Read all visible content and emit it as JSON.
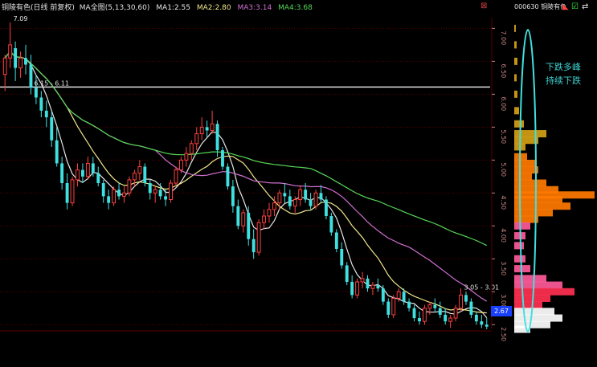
{
  "header": {
    "title": "铜陵有色(日线 前复权)",
    "ma_label": "MA全图(5,13,30,60)",
    "ma_values": [
      {
        "name": "MA1:",
        "value": "2.55",
        "color": "#e6e6e6"
      },
      {
        "name": "MA2:",
        "value": "2.80",
        "color": "#f0e68c"
      },
      {
        "name": "MA3:",
        "value": "3.14",
        "color": "#d070d0"
      },
      {
        "name": "MA4:",
        "value": "3.68",
        "color": "#56d856"
      }
    ]
  },
  "side_panel": {
    "code_label": "000630 铜陵有色",
    "annotation_line1": "下跌多峰",
    "annotation_line2": "持续下跌",
    "current_price": "2.67"
  },
  "colors": {
    "up": "#ff4040",
    "down": "#40e0e0",
    "grid": "#5a0000",
    "axis_text": "#c08080",
    "ma1": "#e6e6e6",
    "ma2": "#f0e68c",
    "ma3": "#d070d0",
    "ma4": "#56d856",
    "hline": "#dddddd",
    "price_box": "#1a40ff",
    "ellipse": "#40e0e0",
    "annotation": "#40d0d0"
  },
  "chart_data": {
    "type": "candlestick",
    "y_axis_ticks": [
      "7.00",
      "6.50",
      "6.00",
      "5.50",
      "5.00",
      "4.50",
      "4.00",
      "3.50",
      "3.00",
      "2.50"
    ],
    "ylim": [
      2.43,
      7.09
    ],
    "annotations": [
      {
        "text": "7.09",
        "price": 7.09,
        "index": 1
      },
      {
        "text": "6.15 - 6.11",
        "price": 6.11,
        "index": 5
      },
      {
        "text": "3.05 - 3.01",
        "price": 3.01,
        "index": 88
      }
    ],
    "horizontal_line_price": 6.11,
    "current_price": 2.67,
    "candles": [
      [
        6.3,
        6.6,
        6.05,
        6.55
      ],
      [
        6.55,
        7.09,
        6.4,
        6.75
      ],
      [
        6.7,
        6.8,
        6.2,
        6.4
      ],
      [
        6.4,
        6.65,
        6.25,
        6.55
      ],
      [
        6.55,
        6.75,
        6.3,
        6.45
      ],
      [
        6.45,
        6.6,
        6.0,
        6.1
      ],
      [
        6.1,
        6.3,
        5.85,
        5.95
      ],
      [
        5.95,
        6.05,
        5.65,
        5.75
      ],
      [
        5.75,
        5.9,
        5.5,
        5.65
      ],
      [
        5.65,
        5.75,
        5.2,
        5.3
      ],
      [
        5.3,
        5.5,
        4.9,
        4.95
      ],
      [
        4.95,
        5.05,
        4.55,
        4.65
      ],
      [
        4.65,
        4.8,
        4.25,
        4.35
      ],
      [
        4.35,
        4.75,
        4.3,
        4.7
      ],
      [
        4.7,
        4.95,
        4.6,
        4.85
      ],
      [
        4.85,
        4.95,
        4.65,
        4.75
      ],
      [
        4.75,
        5.05,
        4.7,
        4.95
      ],
      [
        4.95,
        5.05,
        4.75,
        4.8
      ],
      [
        4.8,
        4.9,
        4.6,
        4.65
      ],
      [
        4.65,
        4.7,
        4.35,
        4.45
      ],
      [
        4.45,
        4.55,
        4.25,
        4.35
      ],
      [
        4.35,
        4.6,
        4.3,
        4.55
      ],
      [
        4.55,
        4.65,
        4.4,
        4.45
      ],
      [
        4.45,
        4.6,
        4.35,
        4.5
      ],
      [
        4.5,
        4.75,
        4.45,
        4.7
      ],
      [
        4.7,
        4.85,
        4.6,
        4.8
      ],
      [
        4.8,
        5.0,
        4.7,
        4.9
      ],
      [
        4.9,
        4.95,
        4.6,
        4.65
      ],
      [
        4.65,
        4.7,
        4.4,
        4.5
      ],
      [
        4.5,
        4.6,
        4.35,
        4.55
      ],
      [
        4.55,
        4.65,
        4.4,
        4.45
      ],
      [
        4.45,
        4.55,
        4.3,
        4.4
      ],
      [
        4.4,
        4.7,
        4.35,
        4.65
      ],
      [
        4.65,
        4.9,
        4.6,
        4.85
      ],
      [
        4.85,
        5.05,
        4.8,
        5.0
      ],
      [
        5.0,
        5.2,
        4.9,
        5.1
      ],
      [
        5.1,
        5.3,
        5.0,
        5.25
      ],
      [
        5.25,
        5.5,
        5.15,
        5.4
      ],
      [
        5.4,
        5.65,
        5.3,
        5.5
      ],
      [
        5.5,
        5.6,
        5.35,
        5.45
      ],
      [
        5.45,
        5.75,
        5.4,
        5.55
      ],
      [
        5.55,
        5.6,
        5.05,
        5.15
      ],
      [
        5.15,
        5.2,
        4.85,
        4.9
      ],
      [
        4.9,
        4.95,
        4.55,
        4.6
      ],
      [
        4.6,
        4.7,
        4.2,
        4.3
      ],
      [
        4.3,
        4.4,
        3.95,
        4.0
      ],
      [
        4.0,
        4.25,
        3.9,
        4.2
      ],
      [
        4.2,
        4.3,
        3.7,
        3.8
      ],
      [
        3.8,
        3.95,
        3.5,
        3.6
      ],
      [
        3.6,
        4.1,
        3.55,
        4.05
      ],
      [
        4.05,
        4.25,
        3.95,
        4.15
      ],
      [
        4.15,
        4.35,
        4.05,
        4.25
      ],
      [
        4.25,
        4.45,
        4.15,
        4.35
      ],
      [
        4.35,
        4.55,
        4.25,
        4.5
      ],
      [
        4.5,
        4.65,
        4.35,
        4.45
      ],
      [
        4.45,
        4.55,
        4.25,
        4.3
      ],
      [
        4.3,
        4.45,
        4.2,
        4.4
      ],
      [
        4.4,
        4.6,
        4.3,
        4.55
      ],
      [
        4.55,
        4.65,
        4.35,
        4.4
      ],
      [
        4.4,
        4.5,
        4.25,
        4.3
      ],
      [
        4.3,
        4.55,
        4.25,
        4.5
      ],
      [
        4.5,
        4.62,
        4.35,
        4.4
      ],
      [
        4.4,
        4.45,
        4.1,
        4.15
      ],
      [
        4.15,
        4.2,
        3.85,
        3.9
      ],
      [
        3.9,
        3.95,
        3.6,
        3.65
      ],
      [
        3.65,
        3.75,
        3.35,
        3.4
      ],
      [
        3.4,
        3.45,
        3.1,
        3.15
      ],
      [
        3.15,
        3.25,
        2.9,
        2.95
      ],
      [
        2.95,
        3.2,
        2.9,
        3.15
      ],
      [
        3.15,
        3.3,
        3.05,
        3.2
      ],
      [
        3.2,
        3.25,
        3.0,
        3.05
      ],
      [
        3.05,
        3.15,
        2.95,
        3.1
      ],
      [
        3.1,
        3.2,
        3.0,
        3.05
      ],
      [
        3.05,
        3.1,
        2.8,
        2.85
      ],
      [
        2.85,
        2.9,
        2.6,
        2.65
      ],
      [
        2.65,
        2.95,
        2.6,
        2.9
      ],
      [
        2.9,
        3.05,
        2.85,
        3.0
      ],
      [
        3.0,
        3.05,
        2.8,
        2.85
      ],
      [
        2.85,
        2.9,
        2.7,
        2.75
      ],
      [
        2.75,
        2.8,
        2.55,
        2.6
      ],
      [
        2.6,
        2.7,
        2.5,
        2.55
      ],
      [
        2.55,
        2.8,
        2.5,
        2.75
      ],
      [
        2.75,
        2.85,
        2.65,
        2.8
      ],
      [
        2.8,
        2.9,
        2.7,
        2.75
      ],
      [
        2.75,
        2.85,
        2.6,
        2.65
      ],
      [
        2.65,
        2.75,
        2.5,
        2.55
      ],
      [
        2.55,
        2.65,
        2.45,
        2.6
      ],
      [
        2.6,
        2.8,
        2.55,
        2.75
      ],
      [
        2.75,
        3.05,
        2.7,
        2.95
      ],
      [
        2.95,
        3.0,
        2.8,
        2.85
      ],
      [
        2.85,
        2.9,
        2.6,
        2.65
      ],
      [
        2.65,
        2.7,
        2.5,
        2.55
      ],
      [
        2.55,
        2.65,
        2.45,
        2.5
      ],
      [
        2.5,
        2.6,
        2.43,
        2.47
      ]
    ],
    "volume_profile": [
      {
        "price": 7.0,
        "w": 2
      },
      {
        "price": 6.75,
        "w": 3
      },
      {
        "price": 6.5,
        "w": 4
      },
      {
        "price": 6.25,
        "w": 3
      },
      {
        "price": 6.0,
        "w": 4
      },
      {
        "price": 5.75,
        "w": 6
      },
      {
        "price": 5.55,
        "w": 12
      },
      {
        "price": 5.4,
        "w": 40
      },
      {
        "price": 5.3,
        "w": 30
      },
      {
        "price": 5.2,
        "w": 14
      },
      {
        "price": 5.05,
        "w": 16
      },
      {
        "price": 4.95,
        "w": 28
      },
      {
        "price": 4.85,
        "w": 30
      },
      {
        "price": 4.75,
        "w": 22
      },
      {
        "price": 4.65,
        "w": 40
      },
      {
        "price": 4.55,
        "w": 55
      },
      {
        "price": 4.47,
        "w": 100
      },
      {
        "price": 4.4,
        "w": 60
      },
      {
        "price": 4.3,
        "w": 70
      },
      {
        "price": 4.2,
        "w": 48
      },
      {
        "price": 4.1,
        "w": 30
      },
      {
        "price": 4.0,
        "w": 20
      },
      {
        "price": 3.85,
        "w": 14
      },
      {
        "price": 3.7,
        "w": 12
      },
      {
        "price": 3.5,
        "w": 14
      },
      {
        "price": 3.35,
        "w": 20
      },
      {
        "price": 3.2,
        "w": 40
      },
      {
        "price": 3.1,
        "w": 60
      },
      {
        "price": 3.0,
        "w": 75
      },
      {
        "price": 2.9,
        "w": 45
      },
      {
        "price": 2.8,
        "w": 35
      },
      {
        "price": 2.7,
        "w": 50
      },
      {
        "price": 2.6,
        "w": 60
      },
      {
        "price": 2.5,
        "w": 45
      },
      {
        "price": 2.43,
        "w": 20
      }
    ]
  }
}
